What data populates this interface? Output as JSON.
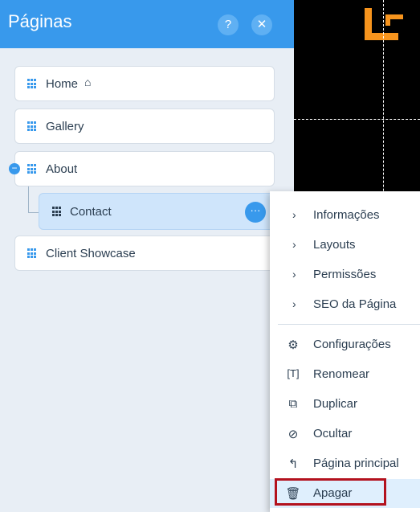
{
  "panel": {
    "title": "Páginas",
    "help_label": "?",
    "close_label": "✕",
    "pages": [
      {
        "label": "Home",
        "is_home": true
      },
      {
        "label": "Gallery"
      },
      {
        "label": "About"
      },
      {
        "label": "Client Showcase"
      }
    ],
    "subpage": {
      "label": "Contact"
    },
    "collapse_label": "−",
    "more_label": "···"
  },
  "menu": {
    "submenus": [
      {
        "label": "Informações"
      },
      {
        "label": "Layouts"
      },
      {
        "label": "Permissões"
      },
      {
        "label": "SEO da Página"
      }
    ],
    "actions": [
      {
        "label": "Configurações",
        "icon": "gear-icon"
      },
      {
        "label": "Renomear",
        "icon": "rename-icon"
      },
      {
        "label": "Duplicar",
        "icon": "duplicate-icon"
      },
      {
        "label": "Ocultar",
        "icon": "hide-eye-icon"
      },
      {
        "label": "Página principal",
        "icon": "return-arrow-icon"
      },
      {
        "label": "Apagar",
        "icon": "trash-icon"
      }
    ],
    "highlight_color": "#b3121e"
  },
  "colors": {
    "accent": "#3899ec",
    "logo": "#f7941d"
  }
}
